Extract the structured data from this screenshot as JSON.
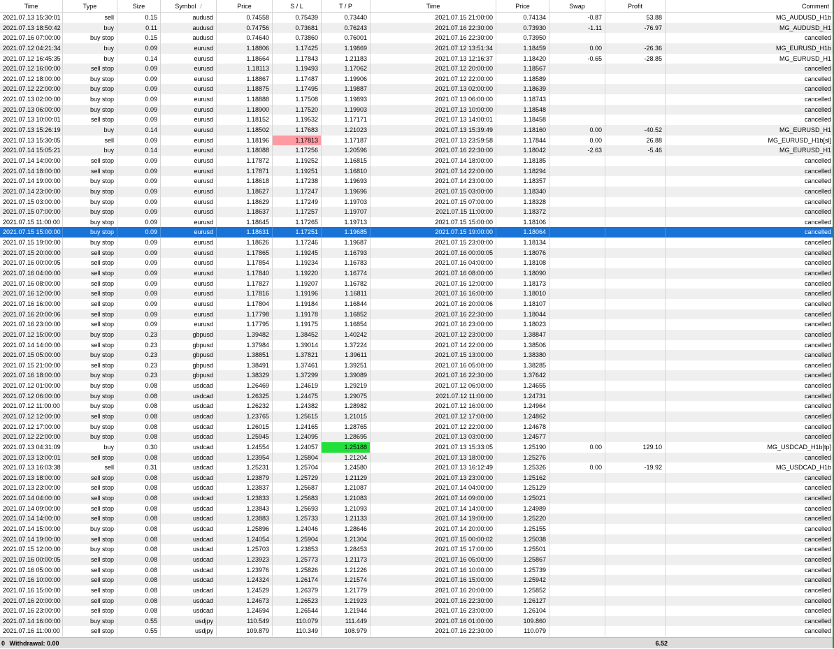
{
  "columns": [
    "Time",
    "Type",
    "Size",
    "Symbol",
    "Price",
    "S / L",
    "T / P",
    "Time",
    "Price",
    "Swap",
    "Profit",
    "Comment"
  ],
  "sort_indicator": "/",
  "rows": [
    [
      "2021.07.13 15:30:01",
      "sell",
      "0.15",
      "audusd",
      "0.74558",
      "0.75439",
      "0.73440",
      "2021.07.15 21:00:00",
      "0.74134",
      "-0.87",
      "53.88",
      "MG_AUDUSD_H1b"
    ],
    [
      "2021.07.13 18:50:42",
      "buy",
      "0.11",
      "audusd",
      "0.74756",
      "0.73681",
      "0.76243",
      "2021.07.16 22:30:00",
      "0.73930",
      "-1.11",
      "-76.97",
      "MG_AUDUSD_H1"
    ],
    [
      "2021.07.16 07:00:00",
      "buy stop",
      "0.15",
      "audusd",
      "0.74640",
      "0.73860",
      "0.76001",
      "2021.07.16 22:30:00",
      "0.73950",
      "",
      "",
      "cancelled"
    ],
    [
      "2021.07.12 04:21:34",
      "buy",
      "0.09",
      "eurusd",
      "1.18806",
      "1.17425",
      "1.19869",
      "2021.07.12 13:51:34",
      "1.18459",
      "0.00",
      "-26.36",
      "MG_EURUSD_H1b"
    ],
    [
      "2021.07.12 16:45:35",
      "buy",
      "0.14",
      "eurusd",
      "1.18664",
      "1.17843",
      "1.21183",
      "2021.07.13 12:16:37",
      "1.18420",
      "-0.65",
      "-28.85",
      "MG_EURUSD_H1"
    ],
    [
      "2021.07.12 16:00:00",
      "sell stop",
      "0.09",
      "eurusd",
      "1.18113",
      "1.19493",
      "1.17062",
      "2021.07.12 20:00:00",
      "1.18567",
      "",
      "",
      "cancelled"
    ],
    [
      "2021.07.12 18:00:00",
      "buy stop",
      "0.09",
      "eurusd",
      "1.18867",
      "1.17487",
      "1.19906",
      "2021.07.12 22:00:00",
      "1.18589",
      "",
      "",
      "cancelled"
    ],
    [
      "2021.07.12 22:00:00",
      "buy stop",
      "0.09",
      "eurusd",
      "1.18875",
      "1.17495",
      "1.19887",
      "2021.07.13 02:00:00",
      "1.18639",
      "",
      "",
      "cancelled"
    ],
    [
      "2021.07.13 02:00:00",
      "buy stop",
      "0.09",
      "eurusd",
      "1.18888",
      "1.17508",
      "1.19893",
      "2021.07.13 06:00:00",
      "1.18743",
      "",
      "",
      "cancelled"
    ],
    [
      "2021.07.13 06:00:00",
      "buy stop",
      "0.09",
      "eurusd",
      "1.18900",
      "1.17520",
      "1.19903",
      "2021.07.13 10:00:00",
      "1.18548",
      "",
      "",
      "cancelled"
    ],
    [
      "2021.07.13 10:00:01",
      "sell stop",
      "0.09",
      "eurusd",
      "1.18152",
      "1.19532",
      "1.17171",
      "2021.07.13 14:00:01",
      "1.18458",
      "",
      "",
      "cancelled"
    ],
    [
      "2021.07.13 15:26:19",
      "buy",
      "0.14",
      "eurusd",
      "1.18502",
      "1.17683",
      "1.21023",
      "2021.07.13 15:39:49",
      "1.18160",
      "0.00",
      "-40.52",
      "MG_EURUSD_H1"
    ],
    [
      "2021.07.13 15:30:05",
      "sell",
      "0.09",
      "eurusd",
      "1.18196",
      "1.17813",
      "1.17187",
      "2021.07.13 23:59:58",
      "1.17844",
      "0.00",
      "26.88",
      "MG_EURUSD_H1b[sl]"
    ],
    [
      "2021.07.14 15:05:21",
      "buy",
      "0.14",
      "eurusd",
      "1.18088",
      "1.17256",
      "1.20596",
      "2021.07.16 22:30:00",
      "1.18042",
      "-2.63",
      "-5.46",
      "MG_EURUSD_H1"
    ],
    [
      "2021.07.14 14:00:00",
      "sell stop",
      "0.09",
      "eurusd",
      "1.17872",
      "1.19252",
      "1.16815",
      "2021.07.14 18:00:00",
      "1.18185",
      "",
      "",
      "cancelled"
    ],
    [
      "2021.07.14 18:00:00",
      "sell stop",
      "0.09",
      "eurusd",
      "1.17871",
      "1.19251",
      "1.16810",
      "2021.07.14 22:00:00",
      "1.18294",
      "",
      "",
      "cancelled"
    ],
    [
      "2021.07.14 19:00:00",
      "buy stop",
      "0.09",
      "eurusd",
      "1.18618",
      "1.17238",
      "1.19693",
      "2021.07.14 23:00:00",
      "1.18357",
      "",
      "",
      "cancelled"
    ],
    [
      "2021.07.14 23:00:00",
      "buy stop",
      "0.09",
      "eurusd",
      "1.18627",
      "1.17247",
      "1.19696",
      "2021.07.15 03:00:00",
      "1.18340",
      "",
      "",
      "cancelled"
    ],
    [
      "2021.07.15 03:00:00",
      "buy stop",
      "0.09",
      "eurusd",
      "1.18629",
      "1.17249",
      "1.19703",
      "2021.07.15 07:00:00",
      "1.18328",
      "",
      "",
      "cancelled"
    ],
    [
      "2021.07.15 07:00:00",
      "buy stop",
      "0.09",
      "eurusd",
      "1.18637",
      "1.17257",
      "1.19707",
      "2021.07.15 11:00:00",
      "1.18372",
      "",
      "",
      "cancelled"
    ],
    [
      "2021.07.15 11:00:00",
      "buy stop",
      "0.09",
      "eurusd",
      "1.18645",
      "1.17265",
      "1.19713",
      "2021.07.15 15:00:00",
      "1.18106",
      "",
      "",
      "cancelled"
    ],
    [
      "2021.07.15 15:00:00",
      "buy stop",
      "0.09",
      "eurusd",
      "1.18631",
      "1.17251",
      "1.19685",
      "2021.07.15 19:00:00",
      "1.18064",
      "",
      "",
      "cancelled"
    ],
    [
      "2021.07.15 19:00:00",
      "buy stop",
      "0.09",
      "eurusd",
      "1.18626",
      "1.17246",
      "1.19687",
      "2021.07.15 23:00:00",
      "1.18134",
      "",
      "",
      "cancelled"
    ],
    [
      "2021.07.15 20:00:00",
      "sell stop",
      "0.09",
      "eurusd",
      "1.17865",
      "1.19245",
      "1.16793",
      "2021.07.16 00:00:05",
      "1.18076",
      "",
      "",
      "cancelled"
    ],
    [
      "2021.07.16 00:00:05",
      "sell stop",
      "0.09",
      "eurusd",
      "1.17854",
      "1.19234",
      "1.16783",
      "2021.07.16 04:00:00",
      "1.18108",
      "",
      "",
      "cancelled"
    ],
    [
      "2021.07.16 04:00:00",
      "sell stop",
      "0.09",
      "eurusd",
      "1.17840",
      "1.19220",
      "1.16774",
      "2021.07.16 08:00:00",
      "1.18090",
      "",
      "",
      "cancelled"
    ],
    [
      "2021.07.16 08:00:00",
      "sell stop",
      "0.09",
      "eurusd",
      "1.17827",
      "1.19207",
      "1.16782",
      "2021.07.16 12:00:00",
      "1.18173",
      "",
      "",
      "cancelled"
    ],
    [
      "2021.07.16 12:00:00",
      "sell stop",
      "0.09",
      "eurusd",
      "1.17816",
      "1.19196",
      "1.16811",
      "2021.07.16 16:00:00",
      "1.18010",
      "",
      "",
      "cancelled"
    ],
    [
      "2021.07.16 16:00:00",
      "sell stop",
      "0.09",
      "eurusd",
      "1.17804",
      "1.19184",
      "1.16844",
      "2021.07.16 20:00:06",
      "1.18107",
      "",
      "",
      "cancelled"
    ],
    [
      "2021.07.16 20:00:06",
      "sell stop",
      "0.09",
      "eurusd",
      "1.17798",
      "1.19178",
      "1.16852",
      "2021.07.16 22:30:00",
      "1.18044",
      "",
      "",
      "cancelled"
    ],
    [
      "2021.07.16 23:00:00",
      "sell stop",
      "0.09",
      "eurusd",
      "1.17795",
      "1.19175",
      "1.16854",
      "2021.07.16 23:00:00",
      "1.18023",
      "",
      "",
      "cancelled"
    ],
    [
      "2021.07.12 15:00:00",
      "buy stop",
      "0.23",
      "gbpusd",
      "1.39482",
      "1.38452",
      "1.40242",
      "2021.07.12 23:00:00",
      "1.38847",
      "",
      "",
      "cancelled"
    ],
    [
      "2021.07.14 14:00:00",
      "sell stop",
      "0.23",
      "gbpusd",
      "1.37984",
      "1.39014",
      "1.37224",
      "2021.07.14 22:00:00",
      "1.38506",
      "",
      "",
      "cancelled"
    ],
    [
      "2021.07.15 05:00:00",
      "buy stop",
      "0.23",
      "gbpusd",
      "1.38851",
      "1.37821",
      "1.39611",
      "2021.07.15 13:00:00",
      "1.38380",
      "",
      "",
      "cancelled"
    ],
    [
      "2021.07.15 21:00:00",
      "sell stop",
      "0.23",
      "gbpusd",
      "1.38491",
      "1.37461",
      "1.39251",
      "2021.07.16 05:00:00",
      "1.38285",
      "",
      "",
      "cancelled"
    ],
    [
      "2021.07.16 18:00:00",
      "buy stop",
      "0.23",
      "gbpusd",
      "1.38329",
      "1.37299",
      "1.39089",
      "2021.07.16 22:30:00",
      "1.37642",
      "",
      "",
      "cancelled"
    ],
    [
      "2021.07.12 01:00:00",
      "buy stop",
      "0.08",
      "usdcad",
      "1.26469",
      "1.24619",
      "1.29219",
      "2021.07.12 06:00:00",
      "1.24655",
      "",
      "",
      "cancelled"
    ],
    [
      "2021.07.12 06:00:00",
      "buy stop",
      "0.08",
      "usdcad",
      "1.26325",
      "1.24475",
      "1.29075",
      "2021.07.12 11:00:00",
      "1.24731",
      "",
      "",
      "cancelled"
    ],
    [
      "2021.07.12 11:00:00",
      "buy stop",
      "0.08",
      "usdcad",
      "1.26232",
      "1.24382",
      "1.28982",
      "2021.07.12 16:00:00",
      "1.24964",
      "",
      "",
      "cancelled"
    ],
    [
      "2021.07.12 12:00:00",
      "sell stop",
      "0.08",
      "usdcad",
      "1.23765",
      "1.25615",
      "1.21015",
      "2021.07.12 17:00:00",
      "1.24862",
      "",
      "",
      "cancelled"
    ],
    [
      "2021.07.12 17:00:00",
      "buy stop",
      "0.08",
      "usdcad",
      "1.26015",
      "1.24165",
      "1.28765",
      "2021.07.12 22:00:00",
      "1.24678",
      "",
      "",
      "cancelled"
    ],
    [
      "2021.07.12 22:00:00",
      "buy stop",
      "0.08",
      "usdcad",
      "1.25945",
      "1.24095",
      "1.28695",
      "2021.07.13 03:00:00",
      "1.24577",
      "",
      "",
      "cancelled"
    ],
    [
      "2021.07.13 04:31:09",
      "buy",
      "0.30",
      "usdcad",
      "1.24554",
      "1.24057",
      "1.25188",
      "2021.07.13 15:33:05",
      "1.25190",
      "0.00",
      "129.10",
      "MG_USDCAD_H1b[tp]"
    ],
    [
      "2021.07.13 13:00:01",
      "sell stop",
      "0.08",
      "usdcad",
      "1.23954",
      "1.25804",
      "1.21204",
      "2021.07.13 18:00:00",
      "1.25276",
      "",
      "",
      "cancelled"
    ],
    [
      "2021.07.13 16:03:38",
      "sell",
      "0.31",
      "usdcad",
      "1.25231",
      "1.25704",
      "1.24580",
      "2021.07.13 16:12:49",
      "1.25326",
      "0.00",
      "-19.92",
      "MG_USDCAD_H1b"
    ],
    [
      "2021.07.13 18:00:00",
      "sell stop",
      "0.08",
      "usdcad",
      "1.23879",
      "1.25729",
      "1.21129",
      "2021.07.13 23:00:00",
      "1.25162",
      "",
      "",
      "cancelled"
    ],
    [
      "2021.07.13 23:00:00",
      "sell stop",
      "0.08",
      "usdcad",
      "1.23837",
      "1.25687",
      "1.21087",
      "2021.07.14 04:00:00",
      "1.25129",
      "",
      "",
      "cancelled"
    ],
    [
      "2021.07.14 04:00:00",
      "sell stop",
      "0.08",
      "usdcad",
      "1.23833",
      "1.25683",
      "1.21083",
      "2021.07.14 09:00:00",
      "1.25021",
      "",
      "",
      "cancelled"
    ],
    [
      "2021.07.14 09:00:00",
      "sell stop",
      "0.08",
      "usdcad",
      "1.23843",
      "1.25693",
      "1.21093",
      "2021.07.14 14:00:00",
      "1.24989",
      "",
      "",
      "cancelled"
    ],
    [
      "2021.07.14 14:00:00",
      "sell stop",
      "0.08",
      "usdcad",
      "1.23883",
      "1.25733",
      "1.21133",
      "2021.07.14 19:00:00",
      "1.25220",
      "",
      "",
      "cancelled"
    ],
    [
      "2021.07.14 15:00:00",
      "buy stop",
      "0.08",
      "usdcad",
      "1.25896",
      "1.24046",
      "1.28646",
      "2021.07.14 20:00:00",
      "1.25155",
      "",
      "",
      "cancelled"
    ],
    [
      "2021.07.14 19:00:00",
      "sell stop",
      "0.08",
      "usdcad",
      "1.24054",
      "1.25904",
      "1.21304",
      "2021.07.15 00:00:02",
      "1.25038",
      "",
      "",
      "cancelled"
    ],
    [
      "2021.07.15 12:00:00",
      "buy stop",
      "0.08",
      "usdcad",
      "1.25703",
      "1.23853",
      "1.28453",
      "2021.07.15 17:00:00",
      "1.25501",
      "",
      "",
      "cancelled"
    ],
    [
      "2021.07.16 00:00:05",
      "sell stop",
      "0.08",
      "usdcad",
      "1.23923",
      "1.25773",
      "1.21173",
      "2021.07.16 05:00:00",
      "1.25867",
      "",
      "",
      "cancelled"
    ],
    [
      "2021.07.16 05:00:00",
      "sell stop",
      "0.08",
      "usdcad",
      "1.23976",
      "1.25826",
      "1.21226",
      "2021.07.16 10:00:00",
      "1.25739",
      "",
      "",
      "cancelled"
    ],
    [
      "2021.07.16 10:00:00",
      "sell stop",
      "0.08",
      "usdcad",
      "1.24324",
      "1.26174",
      "1.21574",
      "2021.07.16 15:00:00",
      "1.25942",
      "",
      "",
      "cancelled"
    ],
    [
      "2021.07.16 15:00:00",
      "sell stop",
      "0.08",
      "usdcad",
      "1.24529",
      "1.26379",
      "1.21779",
      "2021.07.16 20:00:00",
      "1.25852",
      "",
      "",
      "cancelled"
    ],
    [
      "2021.07.16 20:00:00",
      "sell stop",
      "0.08",
      "usdcad",
      "1.24673",
      "1.26523",
      "1.21923",
      "2021.07.16 22:30:00",
      "1.26127",
      "",
      "",
      "cancelled"
    ],
    [
      "2021.07.16 23:00:00",
      "sell stop",
      "0.08",
      "usdcad",
      "1.24694",
      "1.26544",
      "1.21944",
      "2021.07.16 23:00:00",
      "1.26104",
      "",
      "",
      "cancelled"
    ],
    [
      "2021.07.14 16:00:00",
      "buy stop",
      "0.55",
      "usdjpy",
      "110.549",
      "110.079",
      "111.449",
      "2021.07.16 01:00:00",
      "109.860",
      "",
      "",
      "cancelled"
    ],
    [
      "2021.07.16 11:00:00",
      "sell stop",
      "0.55",
      "usdjpy",
      "109.879",
      "110.349",
      "108.979",
      "2021.07.16 22:30:00",
      "110.079",
      "",
      "",
      "cancelled"
    ]
  ],
  "selected_row": 21,
  "highlights": [
    {
      "row": 12,
      "col": 5,
      "kind": "sl"
    },
    {
      "row": 42,
      "col": 6,
      "kind": "tp"
    }
  ],
  "colors": {
    "selection": "#1a73d6",
    "sl_hit": "#ff9aa2",
    "tp_hit": "#22e03c",
    "row_alt": "#efefef"
  },
  "footer": {
    "prefix": "0",
    "label": "Withdrawal: 0.00",
    "total_profit": "6.52"
  }
}
